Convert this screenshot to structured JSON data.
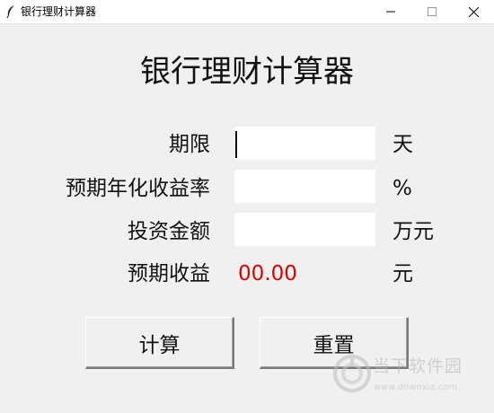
{
  "window": {
    "title": "银行理财计算器"
  },
  "heading": "银行理财计算器",
  "form": {
    "term_label": "期限",
    "term_value": "",
    "term_unit": "天",
    "rate_label": "预期年化收益率",
    "rate_value": "",
    "rate_unit": "%",
    "amount_label": "投资金额",
    "amount_value": "",
    "amount_unit": "万元",
    "income_label": "预期收益",
    "income_value": "00.00",
    "income_unit": "元"
  },
  "buttons": {
    "calculate": "计算",
    "reset": "重置"
  },
  "watermark": {
    "name": "当下软件园",
    "url": "www.downxia.com"
  },
  "colors": {
    "background": "#f0f0f0",
    "result_text": "#e00000",
    "input_background": "#ffffff"
  }
}
